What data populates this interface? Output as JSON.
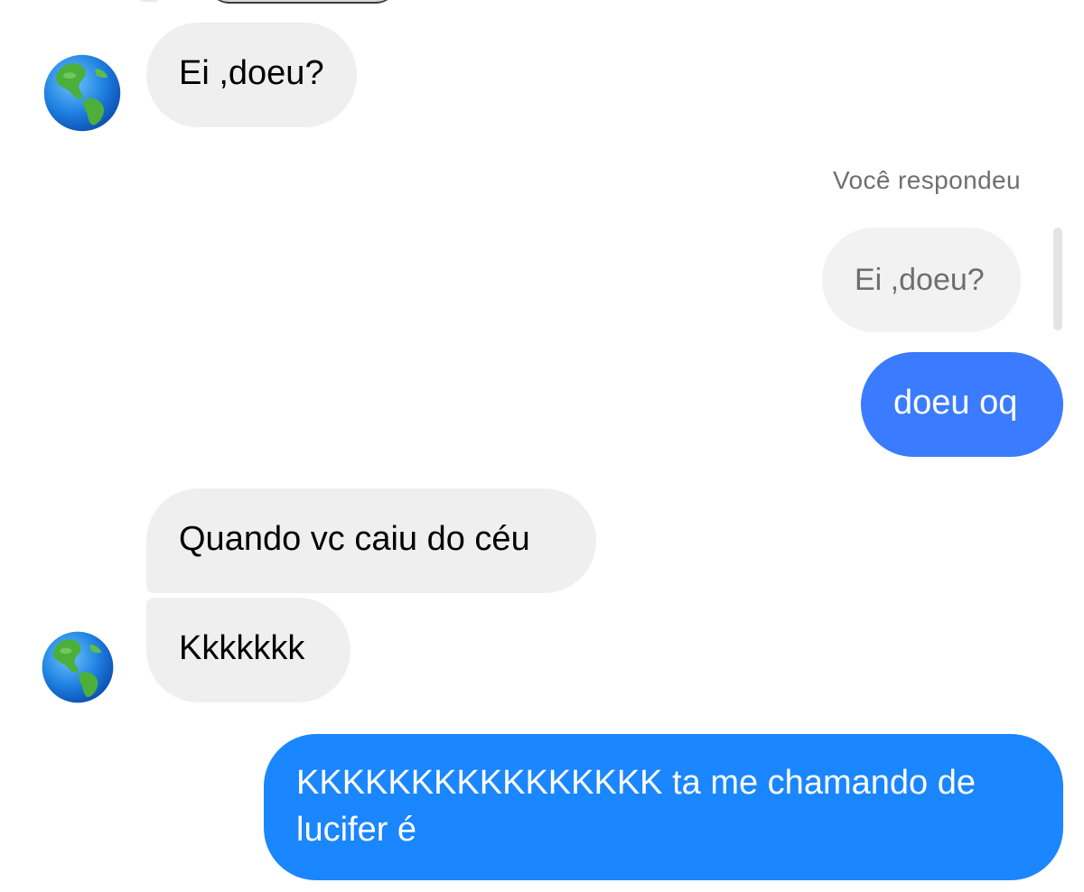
{
  "conversation": {
    "colors": {
      "incoming_bubble": "#efefef",
      "quoted_bubble": "#f2f2f3",
      "outgoing_bubble_1": "#3a7bff",
      "outgoing_bubble_2": "#1a86ff"
    },
    "messages": [
      {
        "from": "them",
        "text": "Ei ,doeu?",
        "avatar": "earth-globe-americas-icon"
      },
      {
        "from": "me",
        "reply_label": "Você respondeu",
        "quoted_text": "Ei ,doeu?"
      },
      {
        "from": "me",
        "text": "doeu oq"
      },
      {
        "from": "them",
        "text": "Quando vc caiu do céu"
      },
      {
        "from": "them",
        "text": "Kkkkkkk",
        "avatar": "earth-globe-americas-icon"
      },
      {
        "from": "me",
        "text": "KKKKKKKKKKKKKKKK ta me chamando de lucifer é"
      }
    ]
  }
}
